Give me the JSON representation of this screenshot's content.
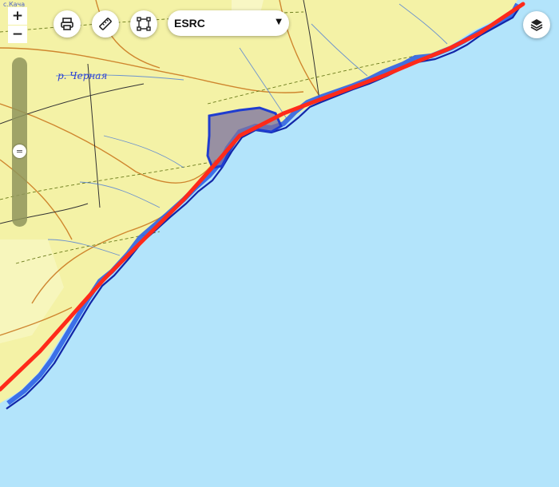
{
  "map": {
    "labels": {
      "river": "р. Черная",
      "top_corner": "с.Кача"
    },
    "colors": {
      "land": "#f4f2a6",
      "sea": "#b3e4fb",
      "coast_line": "#ff2a1a",
      "risk_zone": "#2f62e6"
    }
  },
  "controls": {
    "zoom_in": "+",
    "zoom_out": "−",
    "slider_handle": "=",
    "layer_select": {
      "value": "ESRC",
      "arrow": "▼"
    },
    "icons": [
      "print-icon",
      "ruler-icon",
      "draw-icon",
      "layers-icon"
    ]
  }
}
